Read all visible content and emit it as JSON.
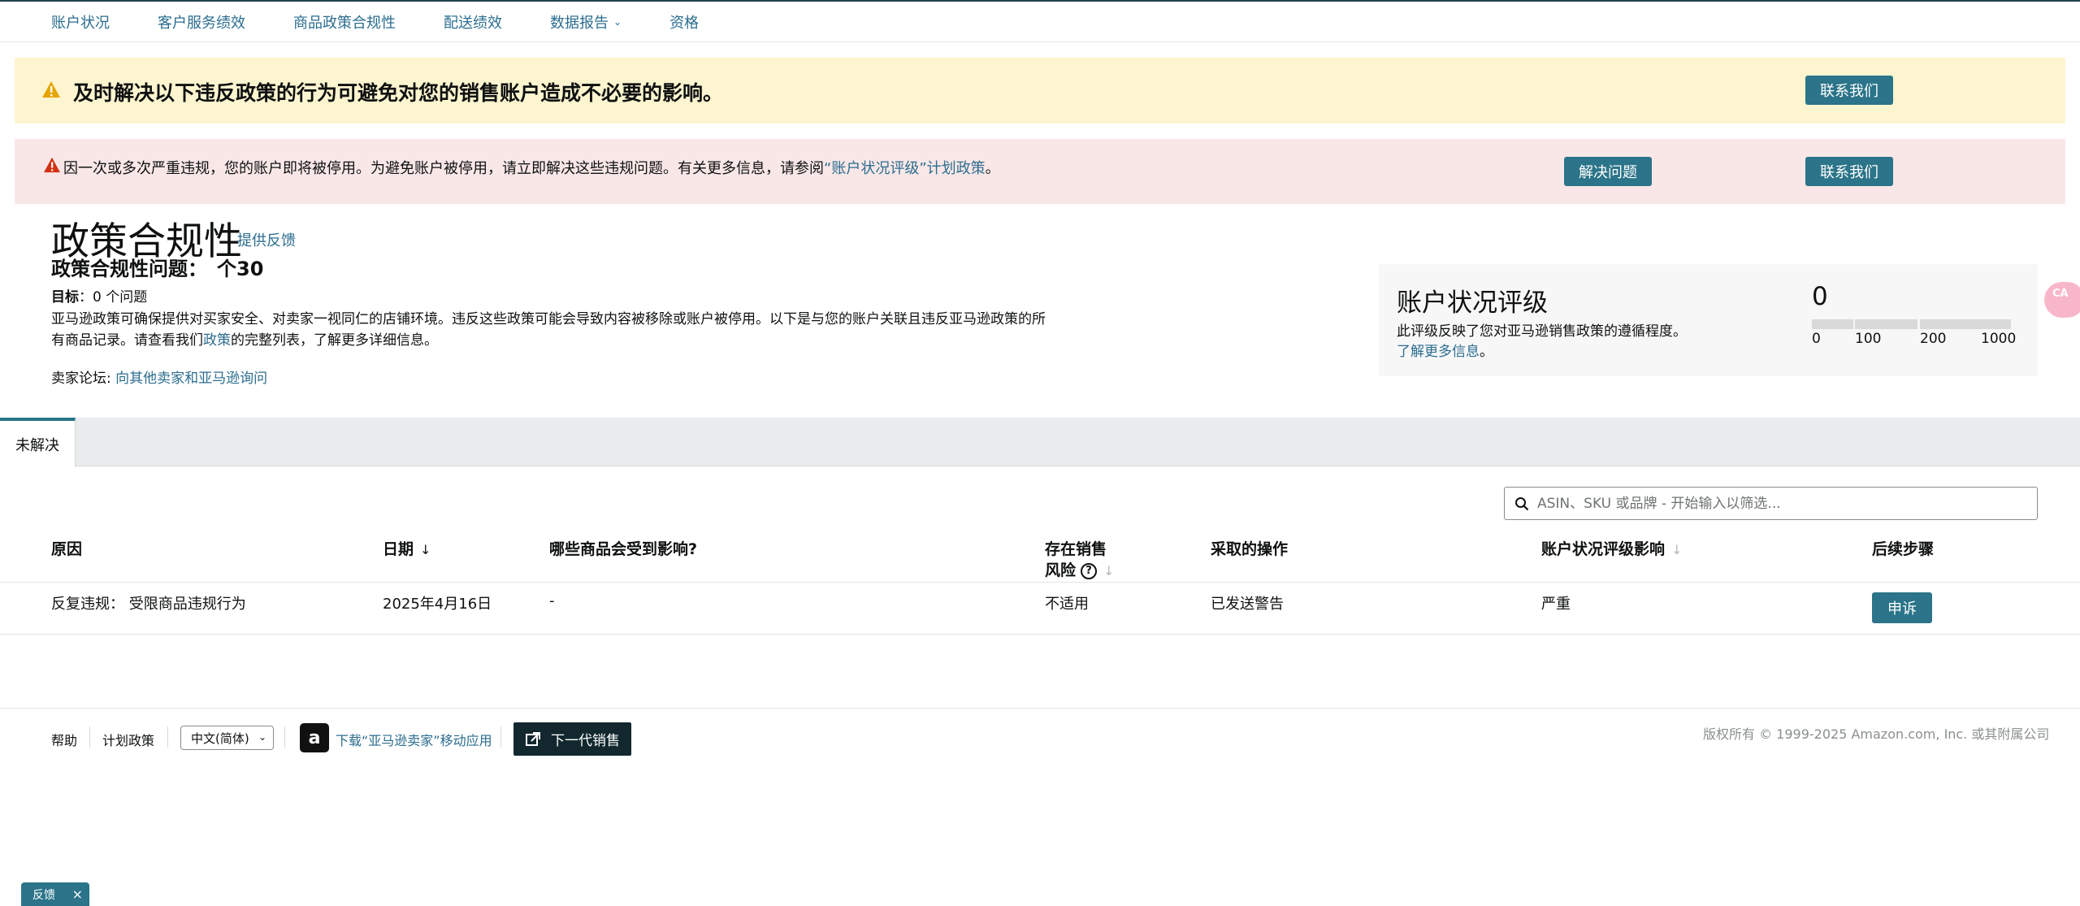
{
  "nav": {
    "items": [
      {
        "label": "账户状况",
        "dropdown": false
      },
      {
        "label": "客户服务绩效",
        "dropdown": false
      },
      {
        "label": "商品政策合规性",
        "dropdown": false
      },
      {
        "label": "配送绩效",
        "dropdown": false
      },
      {
        "label": "数据报告",
        "dropdown": true
      },
      {
        "label": "资格",
        "dropdown": false
      }
    ]
  },
  "warning_banner": {
    "title": "及时解决以下违反政策的行为可避免对您的销售账户造成不必要的影响。",
    "contact_label": "联系我们"
  },
  "error_banner": {
    "text": "因一次或多次严重违规，您的账户即将被停用。为避免账户被停用，请立即解决这些违规问题。有关更多信息，请参阅",
    "link": "“账户状况评级”计划政策",
    "suffix": "。",
    "resolve_label": "解决问题",
    "contact_label": "联系我们"
  },
  "header": {
    "title": "政策合规性",
    "feedback_link": "提供反馈",
    "issues_label": "政策合规性问题：",
    "issues_count": "个30",
    "target_label": "目标",
    "target_value": "：0 个问题",
    "description_1": "亚马逊政策可确保提供对买家安全、对卖家一视同仁的店铺环境。违反这些政策可能会导致内容被移除或账户被停用。以下是与您的账户关联且违反亚马逊政策的所有商品记录。请查看我们",
    "description_link": "政策",
    "description_2": "的完整列表，了解更多详细信息。",
    "forum_label": "卖家论坛:",
    "forum_link": "向其他卖家和亚马逊询问"
  },
  "rating": {
    "title": "账户状况评级",
    "description": "此评级反映了您对亚马逊销售政策的遵循程度。",
    "learn_more": "了解更多信息",
    "learn_more_suffix": "。",
    "value": "0",
    "ticks": [
      "0",
      "100",
      "200",
      "1000"
    ]
  },
  "side_badge": {
    "text": "CA"
  },
  "tabs": [
    {
      "label": "未解决",
      "active": true
    }
  ],
  "search": {
    "placeholder": "ASIN、SKU 或品牌 - 开始输入以筛选..."
  },
  "table": {
    "headers": {
      "reason": "原因",
      "date": "日期",
      "affected": "哪些商品会受到影响?",
      "risk_line1": "存在销售",
      "risk_line2": "风险",
      "action": "采取的操作",
      "impact": "账户状况评级影响",
      "next_steps": "后续步骤"
    },
    "rows": [
      {
        "reason": "反复违规： 受限商品违规行为",
        "date": "2025年4月16日",
        "affected": "-",
        "risk": "不适用",
        "action": "已发送警告",
        "impact": "严重",
        "next_step_label": "申诉"
      }
    ]
  },
  "footer": {
    "help": "帮助",
    "policies": "计划政策",
    "language": "中文(简体)",
    "app_download": "下载“亚马逊卖家”移动应用",
    "next_gen": "下一代销售",
    "copyright": "版权所有 © 1999-2025 Amazon.com, Inc. 或其附属公司"
  },
  "feedback_tab": {
    "label": "反馈",
    "close": "×"
  },
  "colors": {
    "accent": "#2b7489",
    "link": "#2b6d8f",
    "warning_bg": "#fcf5cf",
    "error_bg": "#f9e7e7",
    "warning_icon": "#e6a500",
    "error_icon": "#d13212"
  }
}
